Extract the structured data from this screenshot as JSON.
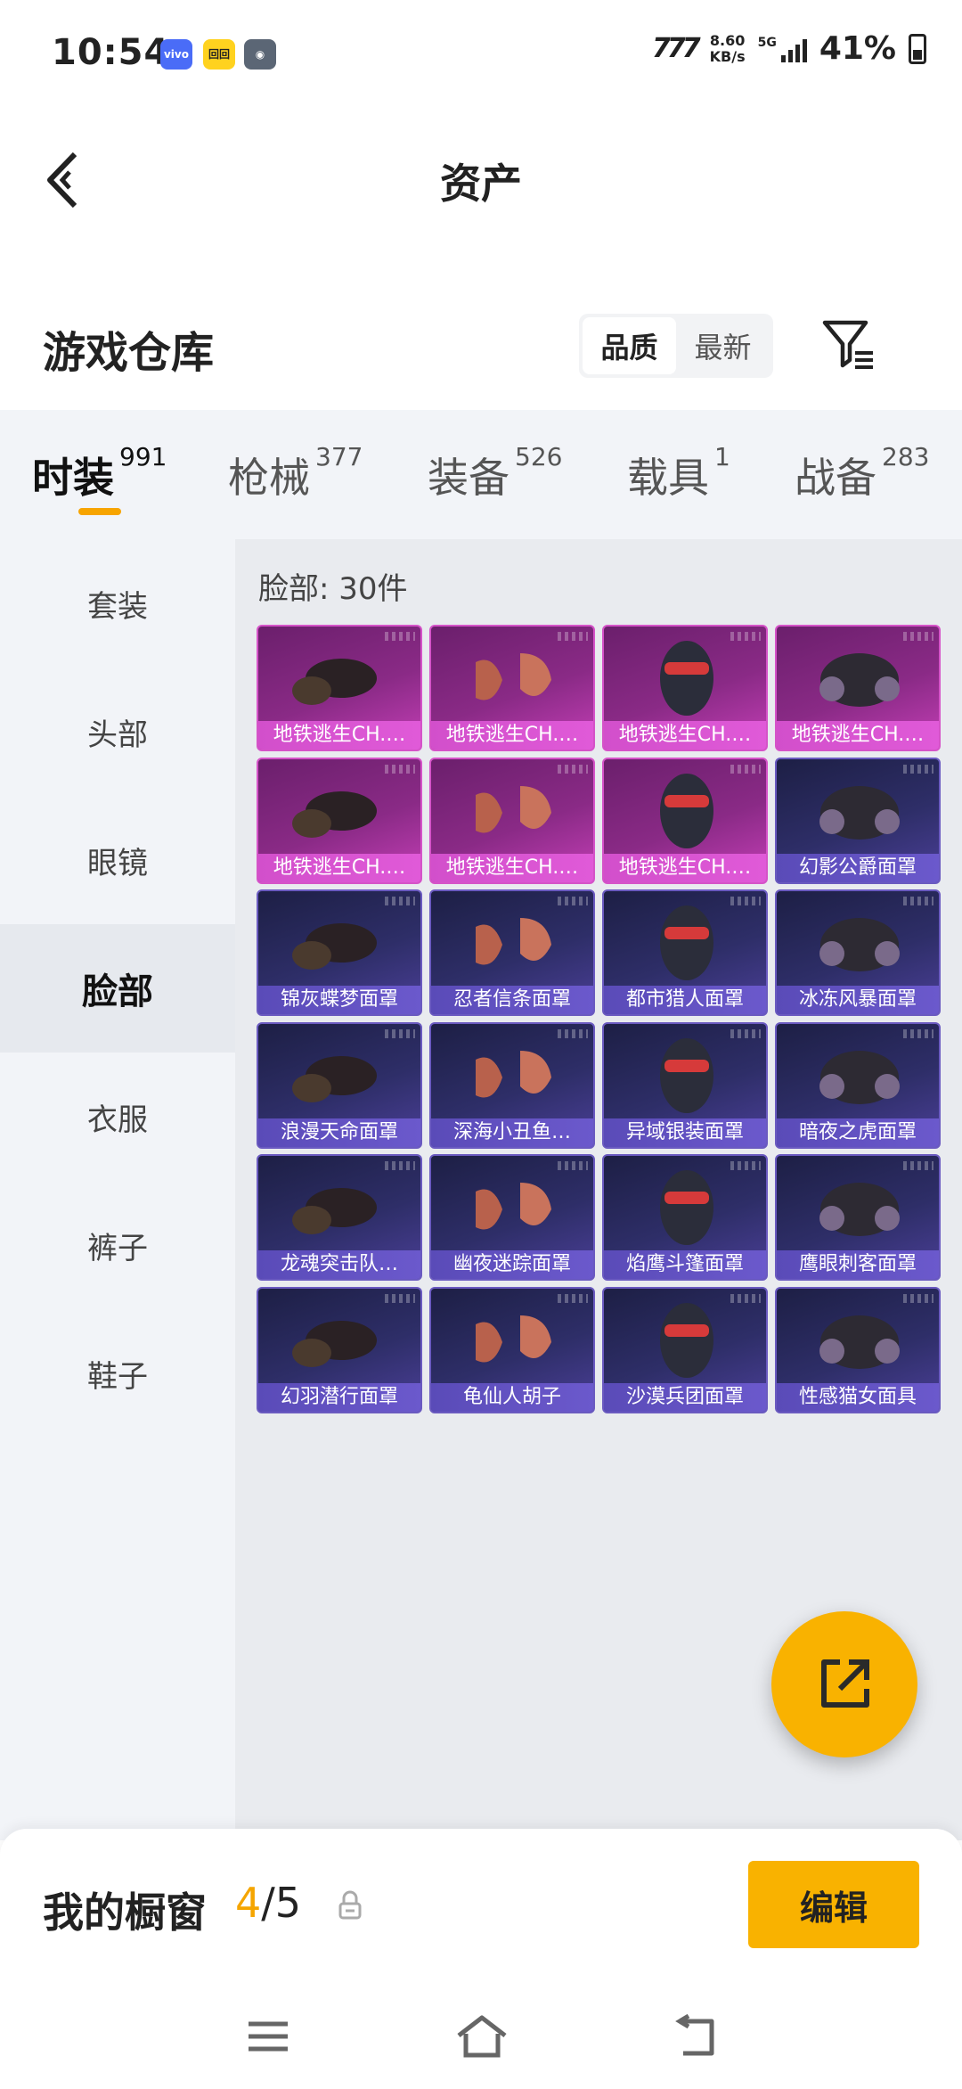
{
  "status_bar": {
    "time": "10:54",
    "badge_vivo": "vivo",
    "badge_y": "回回",
    "net_label": "777",
    "speed_value": "8.60",
    "speed_unit": "KB/s",
    "signal_label": "5G",
    "battery": "41%"
  },
  "header": {
    "title": "资产",
    "back_icon": "chevron-left-icon"
  },
  "warehouse": {
    "title": "游戏仓库",
    "sort_options": [
      "品质",
      "最新"
    ],
    "sort_selected": "品质",
    "filter_icon": "filter-icon"
  },
  "category_tabs": [
    {
      "label": "时装",
      "count": "991",
      "active": true
    },
    {
      "label": "枪械",
      "count": "377"
    },
    {
      "label": "装备",
      "count": "526"
    },
    {
      "label": "载具",
      "count": "1"
    },
    {
      "label": "战备",
      "count": "283"
    }
  ],
  "sidebar": {
    "items": [
      "套装",
      "头部",
      "眼镜",
      "脸部",
      "衣服",
      "裤子",
      "鞋子"
    ],
    "active": "脸部"
  },
  "content": {
    "section_label": "脸部: 30件",
    "items": [
      {
        "name": "地铁逃生CH.…",
        "rarity": "purple"
      },
      {
        "name": "地铁逃生CH.…",
        "rarity": "purple"
      },
      {
        "name": "地铁逃生CH.…",
        "rarity": "purple"
      },
      {
        "name": "地铁逃生CH.…",
        "rarity": "purple"
      },
      {
        "name": "地铁逃生CH.…",
        "rarity": "purple"
      },
      {
        "name": "地铁逃生CH.…",
        "rarity": "purple"
      },
      {
        "name": "地铁逃生CH.…",
        "rarity": "purple"
      },
      {
        "name": "幻影公爵面罩",
        "rarity": "blue"
      },
      {
        "name": "锦灰蝶梦面罩",
        "rarity": "blue"
      },
      {
        "name": "忍者信条面罩",
        "rarity": "blue"
      },
      {
        "name": "都市猎人面罩",
        "rarity": "blue"
      },
      {
        "name": "冰冻风暴面罩",
        "rarity": "blue"
      },
      {
        "name": "浪漫天命面罩",
        "rarity": "blue"
      },
      {
        "name": "深海小丑鱼…",
        "rarity": "blue"
      },
      {
        "name": "异域银装面罩",
        "rarity": "blue"
      },
      {
        "name": "暗夜之虎面罩",
        "rarity": "blue"
      },
      {
        "name": "龙魂突击队…",
        "rarity": "blue"
      },
      {
        "name": "幽夜迷踪面罩",
        "rarity": "blue"
      },
      {
        "name": "焰鹰斗篷面罩",
        "rarity": "blue"
      },
      {
        "name": "鹰眼刺客面罩",
        "rarity": "blue"
      },
      {
        "name": "幻羽潜行面罩",
        "rarity": "blue"
      },
      {
        "name": "龟仙人胡子",
        "rarity": "blue"
      },
      {
        "name": "沙漠兵团面罩",
        "rarity": "blue"
      },
      {
        "name": "性感猫女面具",
        "rarity": "blue"
      }
    ]
  },
  "fab": {
    "icon": "share-external-icon"
  },
  "showcase": {
    "label": "我的橱窗",
    "current": "4",
    "total": "/5",
    "edit_label": "编辑"
  },
  "colors": {
    "accent": "#f9b200",
    "purple_rarity": "#c43fb6",
    "blue_rarity": "#4b3f98"
  }
}
